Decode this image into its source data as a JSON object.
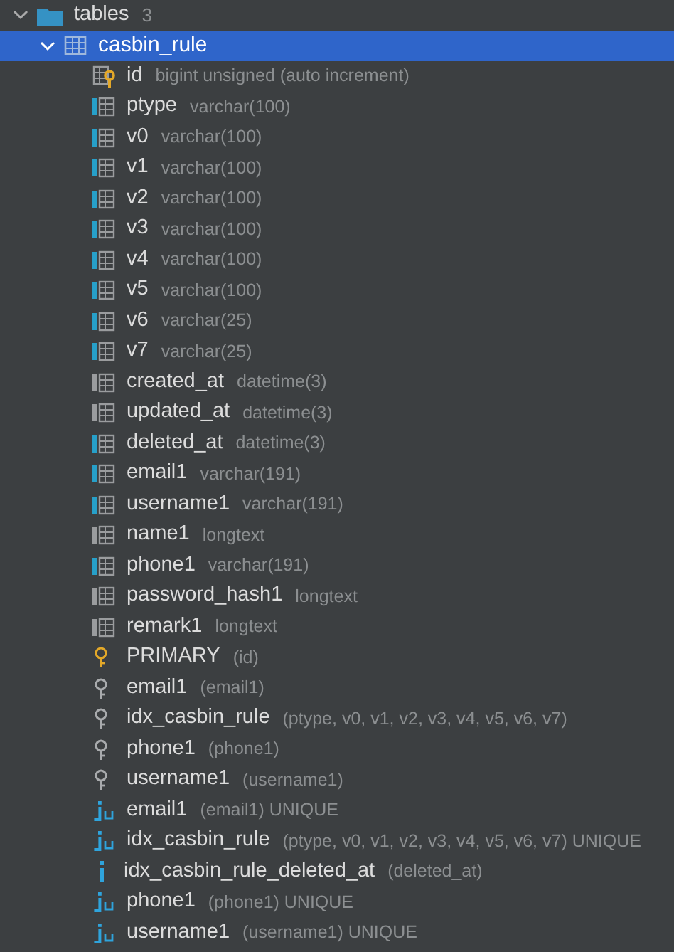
{
  "folder": {
    "label": "tables",
    "count": "3",
    "expanded": true
  },
  "table": {
    "name": "casbin_rule",
    "selected": true,
    "expanded": true,
    "columns": [
      {
        "name": "id",
        "type": "bigint unsigned (auto increment)",
        "kind": "key-column"
      },
      {
        "name": "ptype",
        "type": "varchar(100)",
        "kind": "column",
        "indexed": true
      },
      {
        "name": "v0",
        "type": "varchar(100)",
        "kind": "column",
        "indexed": true
      },
      {
        "name": "v1",
        "type": "varchar(100)",
        "kind": "column",
        "indexed": true
      },
      {
        "name": "v2",
        "type": "varchar(100)",
        "kind": "column",
        "indexed": true
      },
      {
        "name": "v3",
        "type": "varchar(100)",
        "kind": "column",
        "indexed": true
      },
      {
        "name": "v4",
        "type": "varchar(100)",
        "kind": "column",
        "indexed": true
      },
      {
        "name": "v5",
        "type": "varchar(100)",
        "kind": "column",
        "indexed": true
      },
      {
        "name": "v6",
        "type": "varchar(25)",
        "kind": "column",
        "indexed": true
      },
      {
        "name": "v7",
        "type": "varchar(25)",
        "kind": "column",
        "indexed": true
      },
      {
        "name": "created_at",
        "type": "datetime(3)",
        "kind": "column",
        "indexed": false
      },
      {
        "name": "updated_at",
        "type": "datetime(3)",
        "kind": "column",
        "indexed": false
      },
      {
        "name": "deleted_at",
        "type": "datetime(3)",
        "kind": "column",
        "indexed": true
      },
      {
        "name": "email1",
        "type": "varchar(191)",
        "kind": "column",
        "indexed": true
      },
      {
        "name": "username1",
        "type": "varchar(191)",
        "kind": "column",
        "indexed": true
      },
      {
        "name": "name1",
        "type": "longtext",
        "kind": "column",
        "indexed": false
      },
      {
        "name": "phone1",
        "type": "varchar(191)",
        "kind": "column",
        "indexed": true
      },
      {
        "name": "password_hash1",
        "type": "longtext",
        "kind": "column",
        "indexed": false
      },
      {
        "name": "remark1",
        "type": "longtext",
        "kind": "column",
        "indexed": false
      }
    ],
    "keys": [
      {
        "name": "PRIMARY",
        "detail": "(id)",
        "kind": "primary"
      },
      {
        "name": "email1",
        "detail": "(email1)",
        "kind": "key"
      },
      {
        "name": "idx_casbin_rule",
        "detail": "(ptype, v0, v1, v2, v3, v4, v5, v6, v7)",
        "kind": "key"
      },
      {
        "name": "phone1",
        "detail": "(phone1)",
        "kind": "key"
      },
      {
        "name": "username1",
        "detail": "(username1)",
        "kind": "key"
      },
      {
        "name": "email1",
        "detail": "(email1) UNIQUE",
        "kind": "unique"
      },
      {
        "name": "idx_casbin_rule",
        "detail": "(ptype, v0, v1, v2, v3, v4, v5, v6, v7) UNIQUE",
        "kind": "unique"
      },
      {
        "name": "idx_casbin_rule_deleted_at",
        "detail": "(deleted_at)",
        "kind": "index"
      },
      {
        "name": "phone1",
        "detail": "(phone1) UNIQUE",
        "kind": "unique"
      },
      {
        "name": "username1",
        "detail": "(username1) UNIQUE",
        "kind": "unique"
      }
    ]
  }
}
